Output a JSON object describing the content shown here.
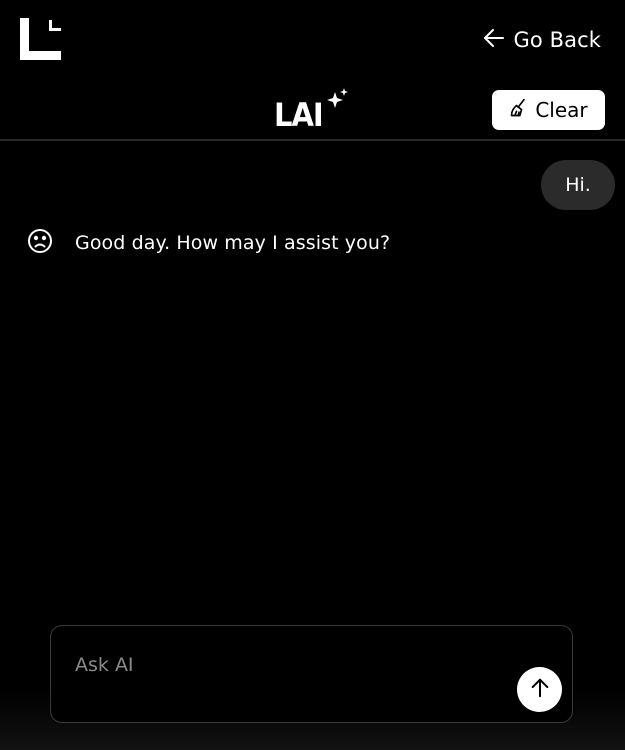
{
  "header": {
    "logo_icon": "corner-l-logo",
    "go_back_label": "Go Back",
    "go_back_icon": "arrow-left-icon",
    "brand_text": "LAI",
    "brand_icon": "sparkle-icon",
    "clear_label": "Clear",
    "clear_icon": "broom-icon"
  },
  "chat": {
    "messages": [
      {
        "role": "user",
        "text": "Hi."
      },
      {
        "role": "assistant",
        "text": "Good day. How may I assist you?",
        "avatar_icon": "frown-face-icon"
      }
    ]
  },
  "composer": {
    "placeholder": "Ask AI",
    "value": "",
    "send_icon": "arrow-up-icon"
  },
  "colors": {
    "background": "#000000",
    "user_bubble": "#2b2b2b",
    "button_bg": "#ffffff",
    "placeholder": "#8a8a8a"
  }
}
